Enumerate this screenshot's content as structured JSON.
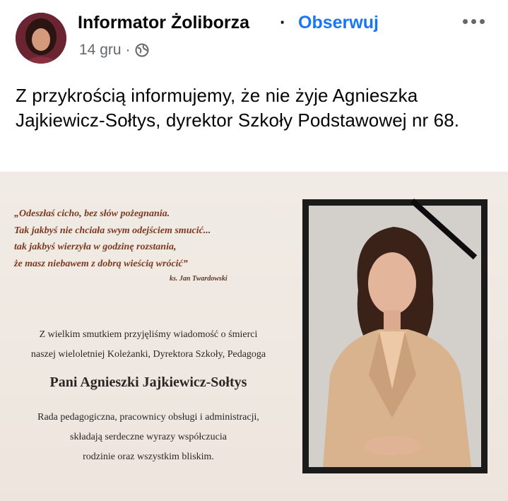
{
  "post": {
    "page_name": "Informator Żoliborza",
    "separator": "·",
    "follow_label": "Obserwuj",
    "date": "14 gru",
    "date_separator": "·",
    "audience_icon": "globe-icon",
    "more_icon": "more-options-icon",
    "text": "Z przykrością informujemy, że nie żyje Agnieszka Jajkiewicz-Sołtys, dyrektor Szkoły Podstawowej nr 68."
  },
  "card": {
    "quote_lines": [
      "„Odeszłaś cicho, bez słów pożegnania.",
      "Tak jakbyś nie chciała swym odejściem smucić...",
      "tak jakbyś wierzyła w godzinę rozstania,",
      "że masz niebawem z dobrą wieścią wrócić”"
    ],
    "quote_author": "ks. Jan Twardowski",
    "intro_lines": [
      "Z wielkim smutkiem przyjęliśmy wiadomość o śmierci",
      "naszej wieloletniej Koleżanki, Dyrektora Szkoły, Pedagoga"
    ],
    "name": "Pani Agnieszki Jajkiewicz-Sołtys",
    "closing_lines": [
      "Rada pedagogiczna, pracownicy obsługi i administracji,",
      "składają serdeczne wyrazy współczucia",
      "rodzinie oraz wszystkim bliskim."
    ]
  },
  "colors": {
    "link": "#1877f2",
    "meta": "#65676b",
    "quote": "#7b3a1f",
    "card_bg": "#efe8e1"
  }
}
